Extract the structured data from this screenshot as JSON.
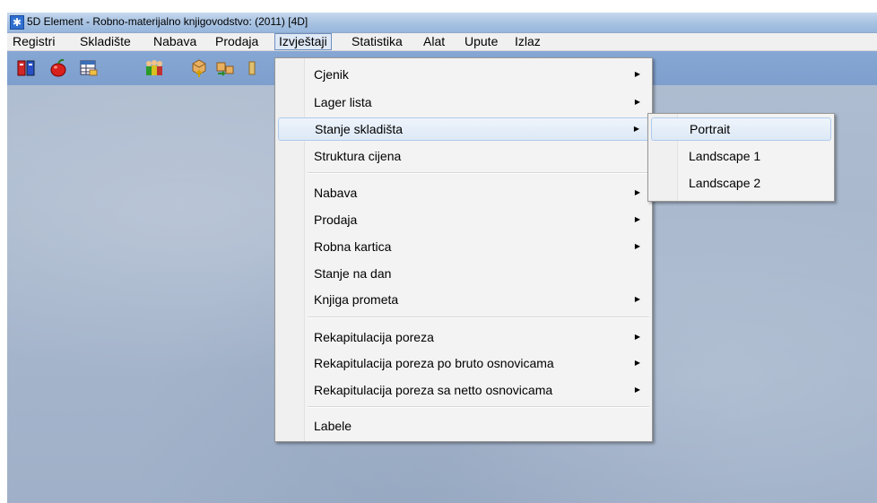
{
  "window": {
    "title": "5D Element - Robno-materijalno knjigovodstvo: (2011) [4D]"
  },
  "menubar": {
    "items": [
      "Registri",
      "Skladište",
      "Nabava",
      "Prodaja",
      "Izvještaji",
      "Statistika",
      "Alat",
      "Upute",
      "Izlaz"
    ],
    "active": "Izvještaji"
  },
  "toolbar": {
    "icons": [
      "binders-icon",
      "apple-icon",
      "table-icon",
      "people-icon",
      "box-up-icon",
      "box-transfer-icon"
    ]
  },
  "menu": {
    "items": [
      {
        "label": "Cjenik",
        "submenu": true
      },
      {
        "label": "Lager lista",
        "submenu": true
      },
      {
        "label": "Stanje skladišta",
        "submenu": true,
        "highlighted": true
      },
      {
        "label": "Struktura cijena",
        "submenu": false
      },
      {
        "label": "Nabava",
        "submenu": true
      },
      {
        "label": "Prodaja",
        "submenu": true
      },
      {
        "label": "Robna kartica",
        "submenu": true
      },
      {
        "label": "Stanje na dan",
        "submenu": false
      },
      {
        "label": "Knjiga prometa",
        "submenu": true
      },
      {
        "label": "Rekapitulacija poreza",
        "submenu": true
      },
      {
        "label": "Rekapitulacija poreza po bruto osnovicama",
        "submenu": true
      },
      {
        "label": "Rekapitulacija poreza sa netto osnovicama",
        "submenu": true
      },
      {
        "label": "Labele",
        "submenu": false
      }
    ]
  },
  "submenu": {
    "items": [
      {
        "label": "Portrait",
        "highlighted": true
      },
      {
        "label": "Landscape 1"
      },
      {
        "label": "Landscape 2"
      }
    ]
  },
  "colors": {
    "toolbar": "#82a3d1",
    "highlight_border": "#aecbed",
    "titlebar": "#a9c3e2"
  }
}
